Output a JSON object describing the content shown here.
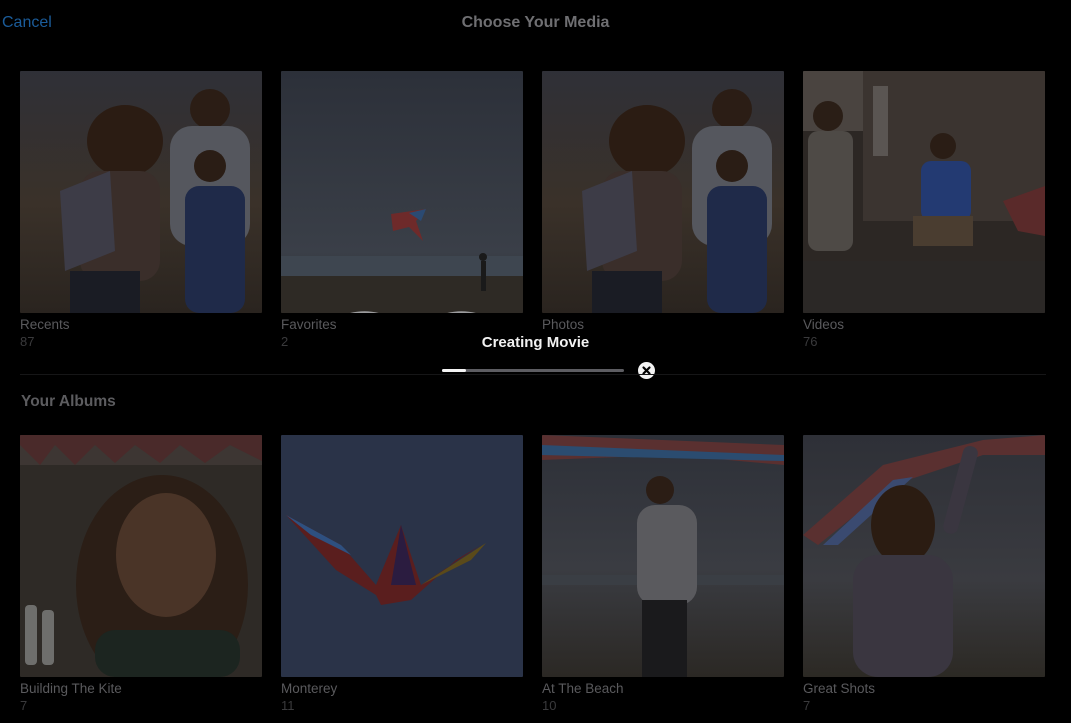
{
  "header": {
    "cancel_label": "Cancel",
    "title": "Choose Your Media"
  },
  "media_types": [
    {
      "label": "Recents",
      "count": "87"
    },
    {
      "label": "Favorites",
      "count": "2",
      "icon": "heart-icon"
    },
    {
      "label": "Photos",
      "count": ""
    },
    {
      "label": "Videos",
      "count": "76"
    }
  ],
  "albums_section": {
    "title": "Your Albums",
    "albums": [
      {
        "label": "Building The Kite",
        "count": "7"
      },
      {
        "label": "Monterey",
        "count": "11"
      },
      {
        "label": "At The Beach",
        "count": "10"
      },
      {
        "label": "Great Shots",
        "count": "7"
      }
    ]
  },
  "progress": {
    "label": "Creating Movie",
    "fraction": 0.13,
    "cancel_icon": "close-circle-icon"
  }
}
